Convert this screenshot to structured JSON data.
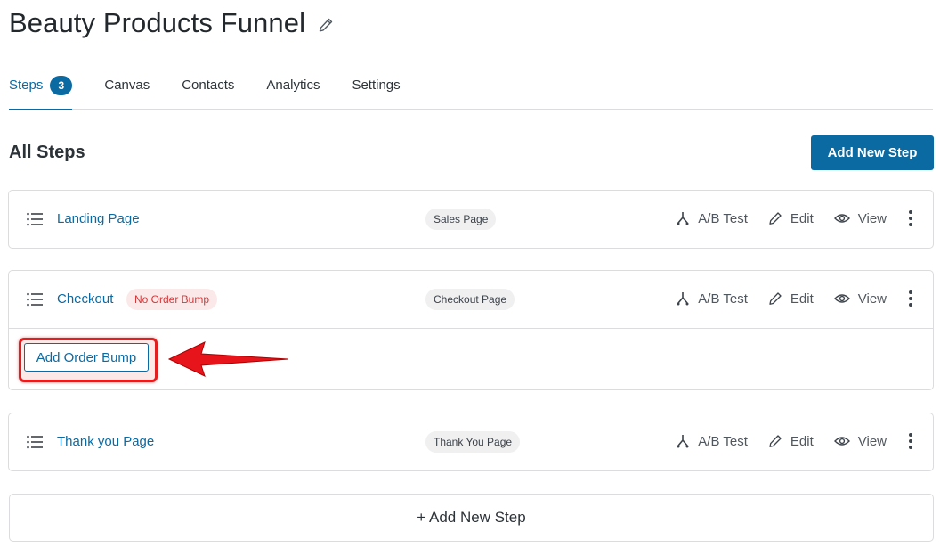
{
  "header": {
    "title": "Beauty Products Funnel"
  },
  "tabs": [
    {
      "label": "Steps",
      "count": "3"
    },
    {
      "label": "Canvas"
    },
    {
      "label": "Contacts"
    },
    {
      "label": "Analytics"
    },
    {
      "label": "Settings"
    }
  ],
  "section": {
    "title": "All Steps",
    "add_button": "Add New Step"
  },
  "actions": {
    "ab_test": "A/B Test",
    "edit": "Edit",
    "view": "View"
  },
  "steps": [
    {
      "name": "Landing Page",
      "type": "Sales Page"
    },
    {
      "name": "Checkout",
      "warning": "No Order Bump",
      "type": "Checkout Page",
      "order_bump_button": "Add Order Bump"
    },
    {
      "name": "Thank you Page",
      "type": "Thank You Page"
    }
  ],
  "footer": {
    "add_step": "+ Add New Step"
  },
  "colors": {
    "accent": "#0b6aa2",
    "warning": "#d63638",
    "annotation": "#e02020"
  }
}
